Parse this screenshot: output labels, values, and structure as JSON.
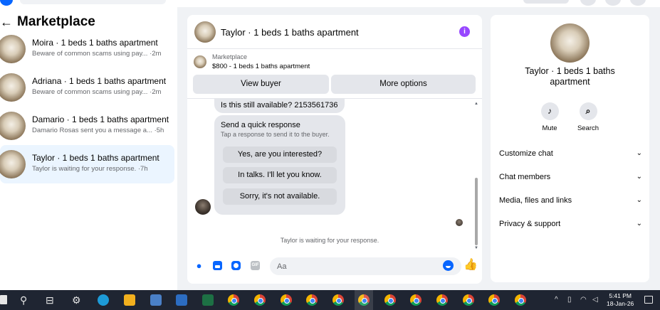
{
  "sidebar": {
    "title": "Marketplace",
    "conversations": [
      {
        "name": "Moira · 1 beds 1 baths apartment",
        "preview": "Beware of common scams using pay... ·2m"
      },
      {
        "name": "Adriana · 1 beds 1 baths apartment",
        "preview": "Beware of common scams using pay... ·2m"
      },
      {
        "name": "Damario · 1 beds 1 baths apartment",
        "preview": "Damario Rosas sent you a message a... ·5h"
      },
      {
        "name": "Taylor · 1 beds 1 baths apartment",
        "preview": "Taylor is waiting for your response. ·7h"
      }
    ]
  },
  "chat": {
    "title": "Taylor · 1 beds 1 baths apartment",
    "listing_source": "Marketplace",
    "listing_price": "$800 - 1 beds 1 baths apartment",
    "view_buyer_label": "View buyer",
    "more_options_label": "More options",
    "availability_message": "Is this still available? 2153561736",
    "quick_response": {
      "title": "Send a quick response",
      "subtitle": "Tap a response to send it to the buyer.",
      "options": [
        "Yes, are you interested?",
        "In talks. I'll let you know.",
        "Sorry, it's not available."
      ]
    },
    "waiting_text": "Taylor is waiting for your response.",
    "composer_placeholder": "Aa",
    "gif_label": "GIF"
  },
  "info_panel": {
    "name": "Taylor · 1 beds 1 baths apartment",
    "actions": {
      "mute": "Mute",
      "search": "Search"
    },
    "sections": [
      "Customize chat",
      "Chat members",
      "Media, files and links",
      "Privacy & support"
    ]
  },
  "taskbar": {
    "time": "5:41 PM",
    "date": "18-Jan-26"
  },
  "colors": {
    "accent": "#0866ff",
    "info_icon": "#9747ff",
    "selected_conversation": "#ebf5ff",
    "taskbar": "#1f2532"
  },
  "icons": [
    "back-arrow-icon",
    "info-icon",
    "mic-icon",
    "image-icon",
    "sticker-icon",
    "gif-icon",
    "emoji-icon",
    "like-icon",
    "bell-icon",
    "search-icon",
    "chevron-down-icon"
  ]
}
